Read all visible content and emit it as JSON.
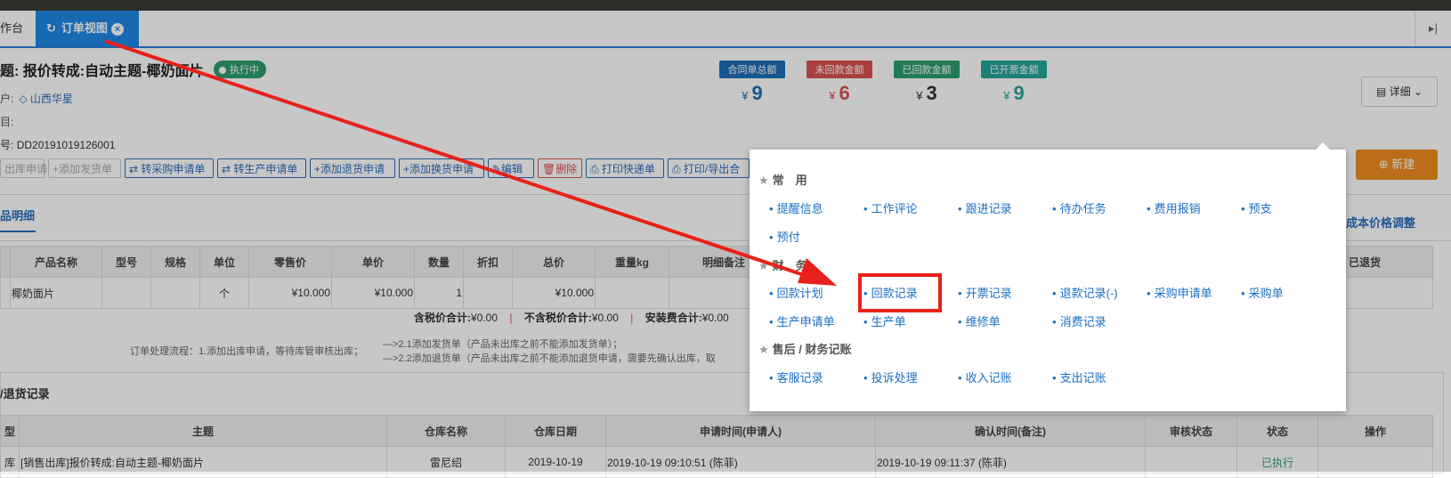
{
  "tabs": {
    "home_label": "作台",
    "active_label": "订单视图",
    "close_symbol": "×",
    "next_symbol": "▸|"
  },
  "order": {
    "title_prefix": "题:",
    "title": "报价转成:自动主题-椰奶面片",
    "status": "执行中",
    "customer_label": "户:",
    "customer": "山西华星",
    "project_label": "目:",
    "number_label": "号:",
    "number": "DD20191019126001"
  },
  "stats": [
    {
      "label": "合同单总额",
      "value": "9",
      "color": "#1f6fb5"
    },
    {
      "label": "未回款金额",
      "value": "6",
      "color": "#d9534f"
    },
    {
      "label": "已回款金额",
      "value": "3",
      "color": "#2e9e6e"
    },
    {
      "label": "已开票金额",
      "value": "9",
      "color": "#26a69a"
    }
  ],
  "currency": "¥",
  "detail_label": "详细",
  "new_label": "新建",
  "toolbar": [
    {
      "label": "出库申请",
      "style": "disabled"
    },
    {
      "label": "+添加发货单",
      "style": "disabled"
    },
    {
      "label": "⇄ 转采购申请单",
      "style": "normal"
    },
    {
      "label": "⇄ 转生产申请单",
      "style": "normal"
    },
    {
      "label": "+添加退货申请",
      "style": "normal"
    },
    {
      "label": "+添加换货申请",
      "style": "normal"
    },
    {
      "label": "✎编辑",
      "style": "normal"
    },
    {
      "label": "🗑删除",
      "style": "danger"
    },
    {
      "label": "⎙ 打印快递单",
      "style": "normal"
    },
    {
      "label": "⎙ 打印/导出合",
      "style": "normal"
    }
  ],
  "section_tab": "品明细",
  "cost_link": "成本价格调整",
  "product_table": {
    "headers": [
      "产品名称",
      "型号",
      "规格",
      "单位",
      "零售价",
      "单价",
      "数量",
      "折扣",
      "总价",
      "重量kg",
      "明细备注",
      "已退货"
    ],
    "row": [
      "椰奶面片",
      "",
      "",
      "个",
      "¥10.000",
      "¥10.000",
      "1",
      "",
      "¥10.000",
      "",
      "",
      ""
    ]
  },
  "totals": {
    "tax_incl_label": "含税价合计:",
    "tax_incl": "¥0.00",
    "tax_excl_label": "不含税价合计:",
    "tax_excl": "¥0.00",
    "install_label": "安装费合计:",
    "install": "¥0.00"
  },
  "flow": {
    "line1": "订单处理流程：1.添加出库申请，等待库管审核出库；",
    "line1b": "—>2.1添加发货单（产品未出库之前不能添加发货单）；",
    "line2": "—>2.2添加退货单（产品未出库之前不能添加退货申请，需要先确认出库，取"
  },
  "return_section": {
    "title": "/退货记录",
    "headers": [
      "型",
      "主题",
      "仓库名称",
      "仓库日期",
      "申请时间(申请人)",
      "确认时间(备注)",
      "审核状态",
      "状态",
      "操作"
    ],
    "row": [
      "库",
      "[销售出库]报价转成:自动主题-椰奶面片",
      "雷尼绍",
      "2019-10-19",
      "2019-10-19 09:10:51 (陈菲)",
      "2019-10-19 09:11:37 (陈菲)",
      "",
      "已执行",
      ""
    ]
  },
  "popup": {
    "groups": [
      {
        "title": "常　用",
        "items": [
          "提醒信息",
          "工作评论",
          "跟进记录",
          "待办任务",
          "费用报销",
          "预支",
          "预付"
        ]
      },
      {
        "title": "财　务",
        "items": [
          "回款计划",
          "回款记录",
          "开票记录",
          "退款记录(-)",
          "采购申请单",
          "采购单",
          "生产申请单",
          "生产单",
          "维修单",
          "消费记录"
        ]
      },
      {
        "title": "售后 / 财务记账",
        "items": [
          "客服记录",
          "投诉处理",
          "收入记账",
          "支出记账"
        ]
      }
    ]
  }
}
